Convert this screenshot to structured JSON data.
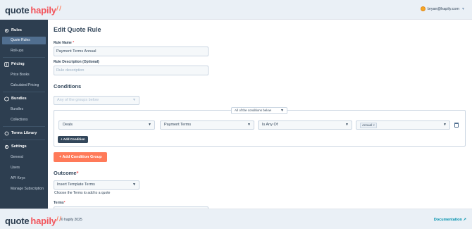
{
  "header": {
    "logo_quote": "quote",
    "logo_hapily": "hapily",
    "user_email": "bryan@hapily.com"
  },
  "sidebar": {
    "sections": [
      {
        "label": "Rules",
        "icon": "gear-icon",
        "items": [
          "Quote Rules",
          "Roll-ups"
        ]
      },
      {
        "label": "Pricing",
        "icon": "dollar-icon",
        "items": [
          "Price Books",
          "Calculated Pricing"
        ]
      },
      {
        "label": "Bundles",
        "icon": "box-icon",
        "items": [
          "Bundles",
          "Collections"
        ]
      },
      {
        "label": "Terms Library",
        "icon": "book-icon",
        "items": []
      },
      {
        "label": "Settings",
        "icon": "settings-icon",
        "items": [
          "General",
          "Users",
          "API Keys",
          "Manage Subscription"
        ]
      }
    ],
    "active_item": "Quote Rules"
  },
  "main": {
    "title": "Edit Quote Rule",
    "rule_name_label": "Rule Name",
    "rule_name_value": "Payment Terms Annual",
    "rule_desc_label": "Rule Description (Optional)",
    "rule_desc_placeholder": "Rule description",
    "conditions_heading": "Conditions",
    "group_select_placeholder": "Any of the groups below",
    "condition_mode": "All of the conditions below",
    "condition": {
      "object": "Deals",
      "property": "Payment Terms",
      "operator": "Is Any Of",
      "value_tag": "Annual"
    },
    "add_condition_label": "+ Add Condition",
    "add_group_label": "+ Add Condition Group",
    "outcome_heading": "Outcome",
    "outcome_select": "Insert Template Terms",
    "outcome_help": "Choose the Terms to add to a quote",
    "terms_label": "Terms"
  },
  "footer": {
    "copyright": "© hapily 2025",
    "documentation": "Documentation"
  }
}
